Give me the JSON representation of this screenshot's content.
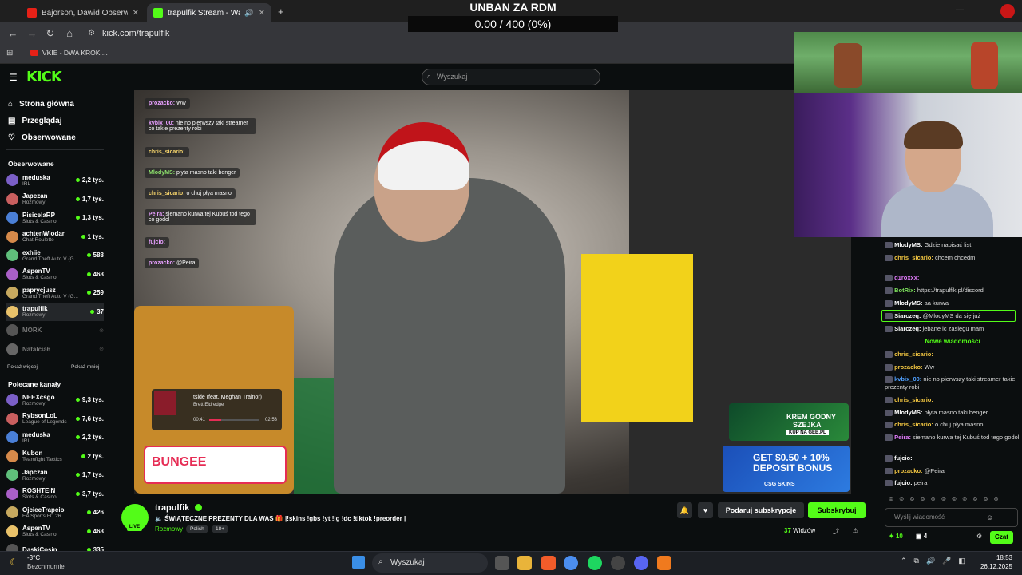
{
  "browser": {
    "tabs": [
      {
        "title": "Bajorson, Dawid Obserwator, D",
        "color": "#e62117"
      },
      {
        "title": "trapulfik Stream - Watch Li",
        "color": "#53fc18"
      }
    ],
    "url": "kick.com/trapulfik",
    "bookmark": "VKIE - DWA KROKI..."
  },
  "overlay": {
    "title": "UNBAN ZA RDM",
    "progress": "0.00 / 400 (0%)",
    "progress_fraction": 0
  },
  "kick": {
    "logo": "KICK",
    "search_placeholder": "Wyszukaj"
  },
  "sidebar": {
    "nav": [
      "Strona główna",
      "Przeglądaj",
      "Obserwowane"
    ],
    "followed_title": "Obserwowane",
    "followed": [
      {
        "name": "meduska",
        "cat": "IRL",
        "viewers": "2,2 tys."
      },
      {
        "name": "Japczan",
        "cat": "Rozmowy",
        "viewers": "1,7 tys."
      },
      {
        "name": "PisicelaRP",
        "cat": "Slots & Casino",
        "viewers": "1,3 tys."
      },
      {
        "name": "achtenWlodar",
        "cat": "Chat Roulette",
        "viewers": "1 tys."
      },
      {
        "name": "exhiie",
        "cat": "Grand Theft Auto V (G...",
        "viewers": "588"
      },
      {
        "name": "AspenTV",
        "cat": "Slots & Casino",
        "viewers": "463"
      },
      {
        "name": "paprycjusz",
        "cat": "Grand Theft Auto V (G...",
        "viewers": "259"
      },
      {
        "name": "trapulfik",
        "cat": "Rozmowy",
        "viewers": "37"
      },
      {
        "name": "MORK",
        "cat": "",
        "viewers": ""
      },
      {
        "name": "Natalcia6",
        "cat": "",
        "viewers": ""
      }
    ],
    "show_more": "Pokaż więcej",
    "show_less": "Pokaż mniej",
    "recommended_title": "Polecane kanały",
    "recommended": [
      {
        "name": "NEEXcsgo",
        "cat": "Rozmowy",
        "viewers": "9,3 tys."
      },
      {
        "name": "RybsonLoL",
        "cat": "League of Legends",
        "viewers": "7,6 tys."
      },
      {
        "name": "meduska",
        "cat": "IRL",
        "viewers": "2,2 tys."
      },
      {
        "name": "Kubon",
        "cat": "Teamfight Tactics",
        "viewers": "2 tys."
      },
      {
        "name": "Japczan",
        "cat": "Rozmowy",
        "viewers": "1,7 tys."
      },
      {
        "name": "ROSHTEIN",
        "cat": "Slots & Casino",
        "viewers": "3,7 tys."
      },
      {
        "name": "OjciecTrapcio",
        "cat": "EA Sports FC 26",
        "viewers": "426"
      },
      {
        "name": "AspenTV",
        "cat": "Slots & Casino",
        "viewers": "463"
      },
      {
        "name": "DaskiCosin",
        "cat": "",
        "viewers": "335"
      }
    ]
  },
  "video_chat": [
    {
      "user": "prozacko:",
      "text": "Ww",
      "c": ""
    },
    {
      "user": "kvbix_00:",
      "text": "nie no pierwszy taki streamer co takie prezenty robi",
      "c": ""
    },
    {
      "user": "chris_sicario:",
      "text": "",
      "c": "y"
    },
    {
      "user": "MlodyMS:",
      "text": "płyta masno taki benger",
      "c": "g"
    },
    {
      "user": "chris_sicario:",
      "text": "o chuj płya masno",
      "c": "y"
    },
    {
      "user": "Peira:",
      "text": "siemano kurwa tej Kubuś tod tego co godol",
      "c": ""
    },
    {
      "user": "fujcio:",
      "text": "",
      "c": ""
    },
    {
      "user": "prozacko:",
      "text": "@Peira",
      "c": ""
    }
  ],
  "spotify": {
    "song": "tside (feat. Meghan Trainor)",
    "artist": "Brett Eldredge",
    "elapsed": "00:41",
    "total": "02:53"
  },
  "ads": {
    "bungee": "BUNGEE",
    "ad1_line1": "KREM GODNY",
    "ad1_line2": "SZEJKA",
    "ad1_line3": "KUP NA GEB.PL",
    "ad2_line1": "GET $0.50 + 10%",
    "ad2_line2": "DEPOSIT BONUS",
    "ad2_line3": "CSG SKINS"
  },
  "chat": {
    "messages": [
      {
        "user": "MlodyMS:",
        "text": "Gdzie napisać list",
        "c": "w"
      },
      {
        "user": "chris_sicario:",
        "text": "chcem chcedm",
        "c": "y"
      },
      {
        "user": "d1roxxx:",
        "text": "",
        "c": "p"
      },
      {
        "user": "BotRix:",
        "text": "https://trapulfik.pl/discord",
        "c": "g"
      },
      {
        "user": "MlodyMS:",
        "text": "aa kurwa",
        "c": "w"
      },
      {
        "user": "Siarczeq:",
        "text": "@MlodyMS da się już",
        "c": "w"
      },
      {
        "user": "Siarczeq:",
        "text": "jebane ic zasięgu mam",
        "c": "w"
      }
    ],
    "new_messages": "Nowe wiadomości",
    "new": [
      {
        "user": "chris_sicario:",
        "text": "",
        "c": "y"
      },
      {
        "user": "prozacko:",
        "text": "Ww",
        "c": "y"
      },
      {
        "user": "kvbix_00:",
        "text": "nie no pierwszy taki streamer takie prezenty robi",
        "c": "b"
      },
      {
        "user": "chris_sicario:",
        "text": "",
        "c": "y"
      },
      {
        "user": "MlodyMS:",
        "text": "płyta masno taki benger",
        "c": "w"
      },
      {
        "user": "chris_sicario:",
        "text": "o chuj płya masno",
        "c": "y"
      },
      {
        "user": "Peira:",
        "text": "siemano kurwa tej Kubuś tod tego godol",
        "c": "p"
      },
      {
        "user": "fujcio:",
        "text": "",
        "c": "w"
      },
      {
        "user": "prozacko:",
        "text": "@Peira",
        "c": "y"
      },
      {
        "user": "fujcio:",
        "text": "peira",
        "c": "w"
      }
    ],
    "input_placeholder": "Wyślij wiadomość",
    "send": "Czat",
    "points": "10",
    "gifts": "4"
  },
  "stream": {
    "name": "trapulfik",
    "title": "🔈 ŚWIĄTECZNE PREZENTY DLA WAS 🎁 |!skins !gbs !yt !ig !dc !tiktok !preorder |",
    "category": "Rozmowy",
    "tags": [
      "Polish",
      "18+"
    ],
    "live": "LIVE",
    "gift_sub": "Podaruj subskrypcje",
    "subscribe": "Subskrybuj",
    "viewers_count": "37",
    "viewers_label": "Widzów"
  },
  "taskbar": {
    "temp": "-3°C",
    "weather": "Bezchmurnie",
    "search": "Wyszukaj",
    "time": "18:53",
    "date": "26.12.2025"
  }
}
